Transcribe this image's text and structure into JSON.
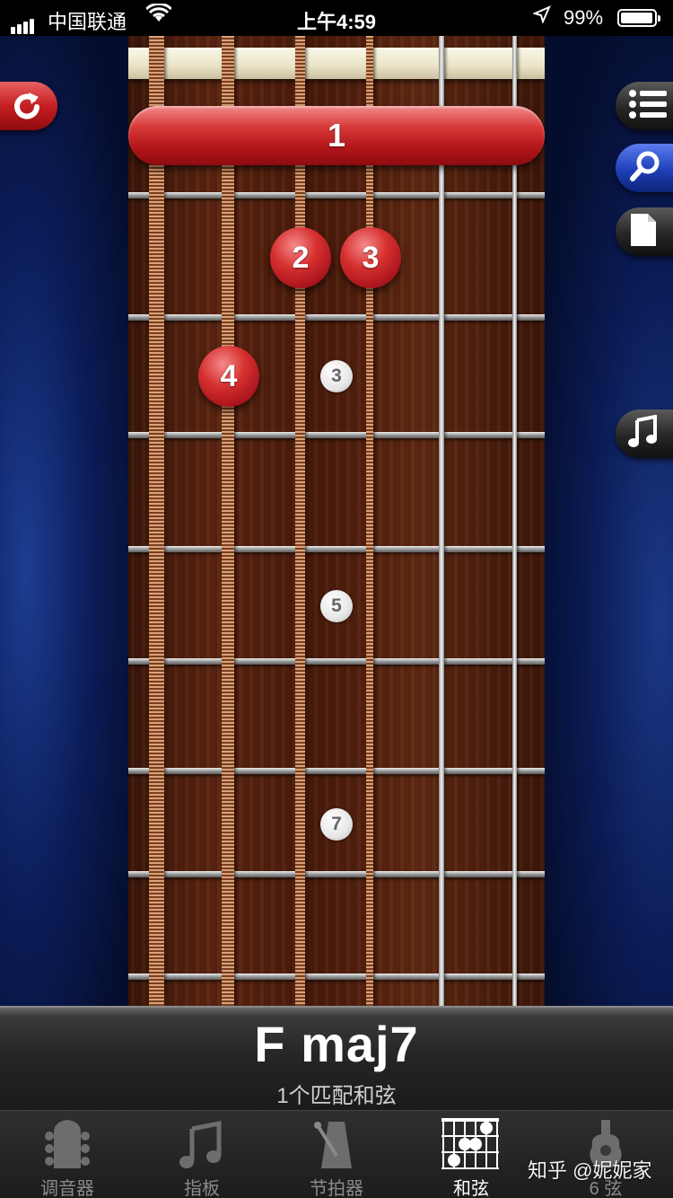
{
  "status_bar": {
    "carrier": "中国联通",
    "time": "上午4:59",
    "battery_percent": "99%",
    "battery_level": 0.99,
    "icons": [
      "signal-icon",
      "wifi-icon",
      "location-arrow-icon",
      "battery-icon"
    ]
  },
  "fretboard": {
    "barre": {
      "finger": "1",
      "fret": 1
    },
    "fingers": [
      {
        "label": "2",
        "fret": 2,
        "string": 3
      },
      {
        "label": "3",
        "fret": 2,
        "string": 4
      },
      {
        "label": "4",
        "fret": 3,
        "string": 2
      }
    ],
    "inlays": [
      "3",
      "5",
      "7"
    ]
  },
  "side_buttons": {
    "left": [
      "refresh-icon"
    ],
    "right": [
      "list-icon",
      "search-icon",
      "document-icon",
      "music-note-icon"
    ]
  },
  "chord": {
    "name": "F maj7",
    "matches": "1个匹配和弦"
  },
  "tabs": [
    {
      "label": "调音器",
      "icon": "tuner-headstock-icon",
      "active": false
    },
    {
      "label": "指板",
      "icon": "music-note-icon",
      "active": false
    },
    {
      "label": "节拍器",
      "icon": "metronome-icon",
      "active": false
    },
    {
      "label": "和弦",
      "icon": "chord-grid-icon",
      "active": true
    },
    {
      "label": "6 弦",
      "icon": "guitar-body-icon",
      "active": false
    }
  ],
  "watermark": "知乎 @妮妮家",
  "colors": {
    "finger_red": "#c51f22",
    "background_blue": "#0b1c55",
    "wood": "#5b2410"
  }
}
